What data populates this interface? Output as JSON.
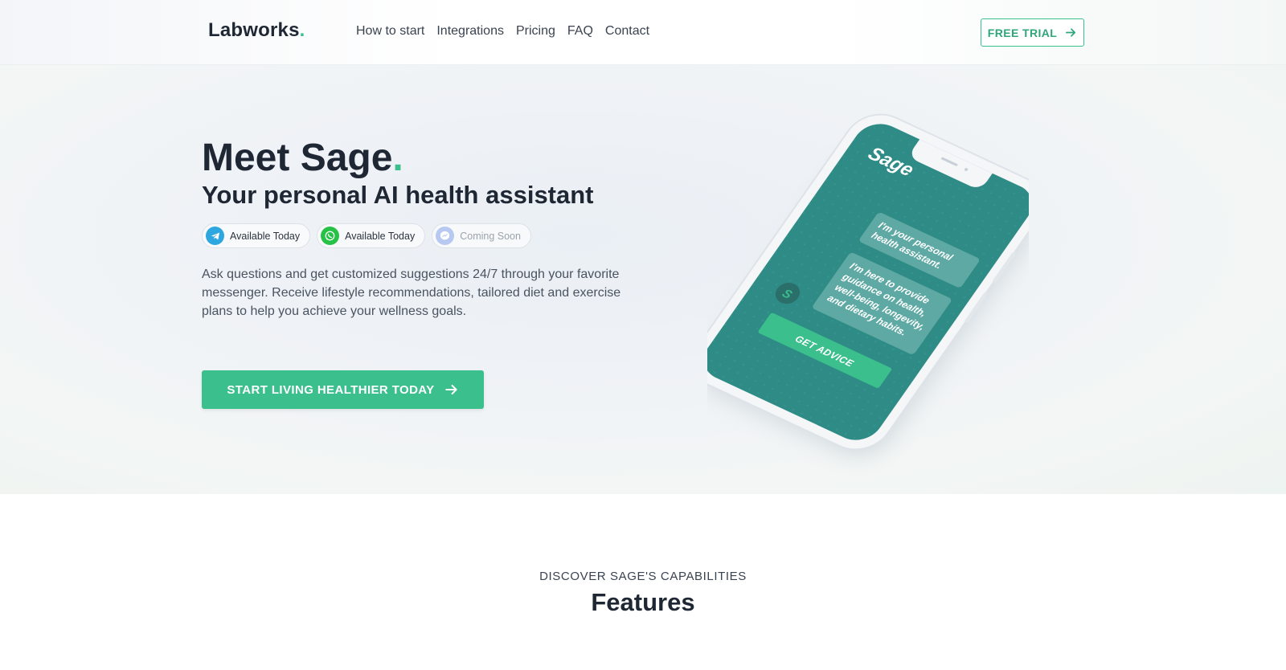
{
  "header": {
    "logo_text": "Labworks",
    "logo_dot": ".",
    "nav": [
      "How to start",
      "Integrations",
      "Pricing",
      "FAQ",
      "Contact"
    ],
    "trial_label": "FREE TRIAL"
  },
  "hero": {
    "title": "Meet Sage",
    "title_dot": ".",
    "subtitle": "Your personal AI health assistant",
    "badges": [
      {
        "label": "Available Today",
        "icon": "telegram-icon"
      },
      {
        "label": "Available Today",
        "icon": "whatsapp-icon"
      },
      {
        "label": "Coming Soon",
        "icon": "messenger-icon"
      }
    ],
    "description": "Ask questions and get customized suggestions 24/7 through your favorite messenger. Receive lifestyle recommendations, tailored diet and exercise plans to help you achieve your wellness goals.",
    "cta_label": "START LIVING HEALTHIER TODAY"
  },
  "phone": {
    "app_name": "Sage",
    "bubble_1": [
      "I'm your personal",
      "health assistant."
    ],
    "bubble_2": [
      "I'm here to provide",
      "guidance on health,",
      "well-being, longevity,",
      "and dietary habits."
    ],
    "avatar_letter": "S",
    "button_label": "GET ADVICE"
  },
  "features": {
    "kicker": "DISCOVER SAGE'S CAPABILITIES",
    "title": "Features"
  },
  "colors": {
    "accent": "#3bbf8d",
    "dark_text": "#1e2733",
    "phone_screen": "#2e8b85",
    "telegram": "#2ea6e0",
    "whatsapp": "#27c146",
    "messenger": "#b7c9f0"
  }
}
